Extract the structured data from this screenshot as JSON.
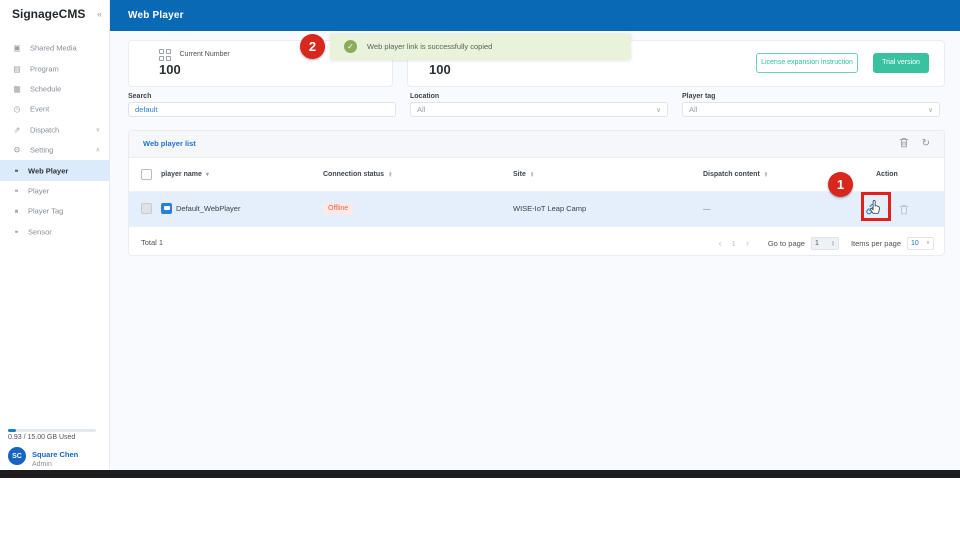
{
  "app": {
    "brand": "SignageCMS",
    "page_title": "Web Player"
  },
  "icons": {
    "collapse": "«",
    "chevron_down": "∨",
    "chevron_up": "∧",
    "dropdown_chevron": "∨",
    "refresh": "↻",
    "prev": "‹",
    "next": "›",
    "check": "✓",
    "sort_up": "▲",
    "sort_down": "▼",
    "caret_down": "▾",
    "external_mini": "▫"
  },
  "sidebar": {
    "items": [
      {
        "label": "Shared Media",
        "glyph": "▣"
      },
      {
        "label": "Program",
        "glyph": "▤"
      },
      {
        "label": "Schedule",
        "glyph": "▦"
      },
      {
        "label": "Event",
        "glyph": "◷"
      },
      {
        "label": "Dispatch",
        "glyph": "⇗",
        "chevron": "∨"
      },
      {
        "label": "Setting",
        "glyph": "⚙",
        "chevron": "∧"
      }
    ],
    "setting_children": [
      {
        "label": "Web Player"
      },
      {
        "label": "Player"
      },
      {
        "label": "Player Tag"
      },
      {
        "label": "Sensor"
      }
    ],
    "storage_text": "0.93 / 15.00 GB Used",
    "user": {
      "initials": "SC",
      "name": "Square Chen",
      "role": "Admin"
    }
  },
  "toast": {
    "message": "Web player link is successfully copied"
  },
  "stats": {
    "current": {
      "label": "Current Number",
      "value": "100"
    },
    "secondary": {
      "value": "100"
    }
  },
  "buttons": {
    "license": "License expansion instruction",
    "trial": "Trial version"
  },
  "filters": {
    "search": {
      "label": "Search",
      "value": "default"
    },
    "location": {
      "label": "Location",
      "value": "All"
    },
    "player_tag": {
      "label": "Player tag",
      "value": "All"
    }
  },
  "table": {
    "title": "Web player list",
    "columns": {
      "name": "player name",
      "status": "Connection status",
      "site": "Site",
      "dispatch": "Dispatch content",
      "action": "Action"
    },
    "row": {
      "name": "Default_WebPlayer",
      "status": "Offline",
      "site": "WISE-IoT Leap Camp",
      "dispatch": "—"
    },
    "footer": {
      "total": "Total 1",
      "page": "1",
      "go_to_page_label": "Go to page",
      "go_to_page_value": "1",
      "items_per_page_label": "Items per page",
      "page_size": "10"
    }
  },
  "annotations": {
    "step1": "1",
    "step2": "2"
  },
  "colors": {
    "header_blue": "#0a69b4",
    "link_blue": "#1c75d2",
    "teal": "#38c2a0",
    "annotation_red": "#d8271c",
    "offline_red": "#f2604e",
    "offline_bg": "#fdeae7",
    "toast_bg": "#e9f2da",
    "toast_icon_green": "#8cab5e",
    "row_highlight": "#e4effb"
  }
}
